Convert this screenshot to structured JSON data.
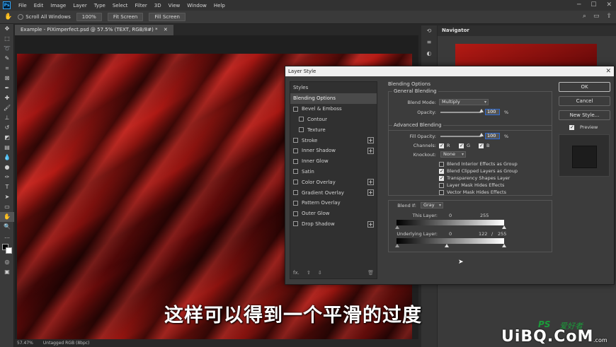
{
  "menubar": {
    "logo": "Ps",
    "items": [
      "File",
      "Edit",
      "Image",
      "Layer",
      "Type",
      "Select",
      "Filter",
      "3D",
      "View",
      "Window",
      "Help"
    ]
  },
  "optionsbar": {
    "scroll_all": "Scroll All Windows",
    "zoom_btn": "100%",
    "fit_btn": "Fit Screen",
    "fill_btn": "Fill Screen"
  },
  "document": {
    "tab_title": "Example - PiXimperfect.psd @ 57.5% (TEXT, RGB/8#) *",
    "zoom_status": "57.47%",
    "profile_status": "Untagged RGB (8bpc)"
  },
  "navigator": {
    "title": "Navigator"
  },
  "dialog": {
    "title": "Layer Style",
    "styles_header": "Styles",
    "styles": [
      {
        "label": "Blending Options",
        "active": true,
        "plus": false,
        "sub": false
      },
      {
        "label": "Bevel & Emboss",
        "active": false,
        "plus": false,
        "sub": false
      },
      {
        "label": "Contour",
        "active": false,
        "plus": false,
        "sub": true
      },
      {
        "label": "Texture",
        "active": false,
        "plus": false,
        "sub": true
      },
      {
        "label": "Stroke",
        "active": false,
        "plus": true,
        "sub": false
      },
      {
        "label": "Inner Shadow",
        "active": false,
        "plus": true,
        "sub": false
      },
      {
        "label": "Inner Glow",
        "active": false,
        "plus": false,
        "sub": false
      },
      {
        "label": "Satin",
        "active": false,
        "plus": false,
        "sub": false
      },
      {
        "label": "Color Overlay",
        "active": false,
        "plus": true,
        "sub": false
      },
      {
        "label": "Gradient Overlay",
        "active": false,
        "plus": true,
        "sub": false
      },
      {
        "label": "Pattern Overlay",
        "active": false,
        "plus": false,
        "sub": false
      },
      {
        "label": "Outer Glow",
        "active": false,
        "plus": false,
        "sub": false
      },
      {
        "label": "Drop Shadow",
        "active": false,
        "plus": true,
        "sub": false
      }
    ],
    "footer_fx": "fx.",
    "blending_options_title": "Blending Options",
    "general_blending_title": "General Blending",
    "blend_mode_label": "Blend Mode:",
    "blend_mode_value": "Multiply",
    "opacity_label": "Opacity:",
    "opacity_value": "100",
    "percent": "%",
    "advanced_blending_title": "Advanced Blending",
    "fill_opacity_label": "Fill Opacity:",
    "fill_opacity_value": "100",
    "channels_label": "Channels:",
    "channel_r": "R",
    "channel_g": "G",
    "channel_b": "B",
    "knockout_label": "Knockout:",
    "knockout_value": "None",
    "checks": [
      {
        "label": "Blend Interior Effects as Group",
        "on": false
      },
      {
        "label": "Blend Clipped Layers as Group",
        "on": true
      },
      {
        "label": "Transparency Shapes Layer",
        "on": true
      },
      {
        "label": "Layer Mask Hides Effects",
        "on": false
      },
      {
        "label": "Vector Mask Hides Effects",
        "on": false
      }
    ],
    "blend_if_label": "Blend If:",
    "blend_if_value": "Gray",
    "this_layer_label": "This Layer:",
    "this_layer_min": "0",
    "this_layer_max": "255",
    "underlying_label": "Underlying Layer:",
    "underlying_min": "0",
    "underlying_mid": "122",
    "underlying_slash": "/",
    "underlying_max": "255",
    "ok_label": "OK",
    "cancel_label": "Cancel",
    "new_style_label": "New Style...",
    "preview_label": "Preview"
  },
  "subtitle": "这样可以得到一个平滑的过度",
  "watermark": {
    "ps": "PS",
    "cn": "爱好者",
    "main": "UiBQ.CoM",
    "com": ".com"
  }
}
